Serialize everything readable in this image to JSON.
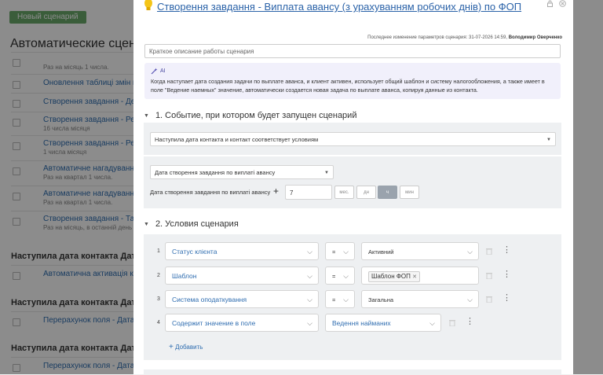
{
  "background": {
    "new_button": "Новый сценарий",
    "heading": "Автоматические сцена",
    "rows": [
      {
        "title": "",
        "sub": "Раз на місяць 1 числа."
      },
      {
        "title": "Оновлення таблиці змін в ка",
        "sub": ""
      },
      {
        "title": "Створення завдання - Декла",
        "sub": ""
      },
      {
        "title": "Створення завдання - Реестр",
        "sub": "16 числа місяця"
      },
      {
        "title": "Створення завдання - Реестр",
        "sub": "1 числа місяця"
      },
      {
        "title": "Автоматичне нагадування - ,",
        "sub": "Раз на квартал 1 числа."
      },
      {
        "title": "Автоматичне нагадування - ,",
        "sub": "Раз на квартал 1 числа."
      },
      {
        "title": "Створення завдання - Табел",
        "sub": "Раз на місяць, в останній день мі"
      }
    ],
    "groups": [
      {
        "title": "Наступила дата контакта Дата",
        "row": "Автоматична активація конт"
      },
      {
        "title": "Наступила дата контакта Дата",
        "row": "Перерахунок поля - Дата ви"
      },
      {
        "title": "Наступила дата контакта Дата",
        "row": "Перерахунок поля - Дата ви"
      }
    ]
  },
  "modal": {
    "title": "Створення завдання - Виплата авансу (з урахуванням робочих днів) по ФОП",
    "last_modified_label": "Последнее изменение параметров сценария: 31-07-2026 14:59,",
    "last_modified_user": "Володимир Оверченко",
    "description_placeholder": "Краткое описание работы сценария",
    "ai": {
      "label": "AI",
      "text": "Когда наступает дата создания задачи по выплате аванса, и клиент активен, использует общий шаблон и систему налогообложения, а также имеет в поле \"Ведение наемных\" значение, автоматически создается новая задача по выплате аванса, копируя данные из контакта."
    },
    "section1": {
      "heading": "1. Событие, при котором будет запущен сценарий",
      "event_select": "Наступила дата контакта и контакт соответствует условиям",
      "date_field_select": "Дата створення завдання по виплаті авансу",
      "offset_label": "Дата створення завдання по виплаті авансу",
      "plus": "+",
      "offset_value": "7",
      "units": [
        "мес.",
        "дн",
        "ч",
        "мин"
      ]
    },
    "section2": {
      "heading": "2. Условия сценария",
      "conditions": [
        {
          "num": "1",
          "field": "Статус клієнта",
          "op": "=",
          "value": "Активний"
        },
        {
          "num": "2",
          "field": "Шаблон",
          "op": "=",
          "chip": "Шаблон ФОП"
        },
        {
          "num": "3",
          "field": "Система оподаткування",
          "op": "=",
          "value": "Загальна"
        },
        {
          "num": "4",
          "field": "Содержит значение в поле",
          "value": "Ведення найманих"
        }
      ],
      "add_label": "Добавить"
    }
  }
}
